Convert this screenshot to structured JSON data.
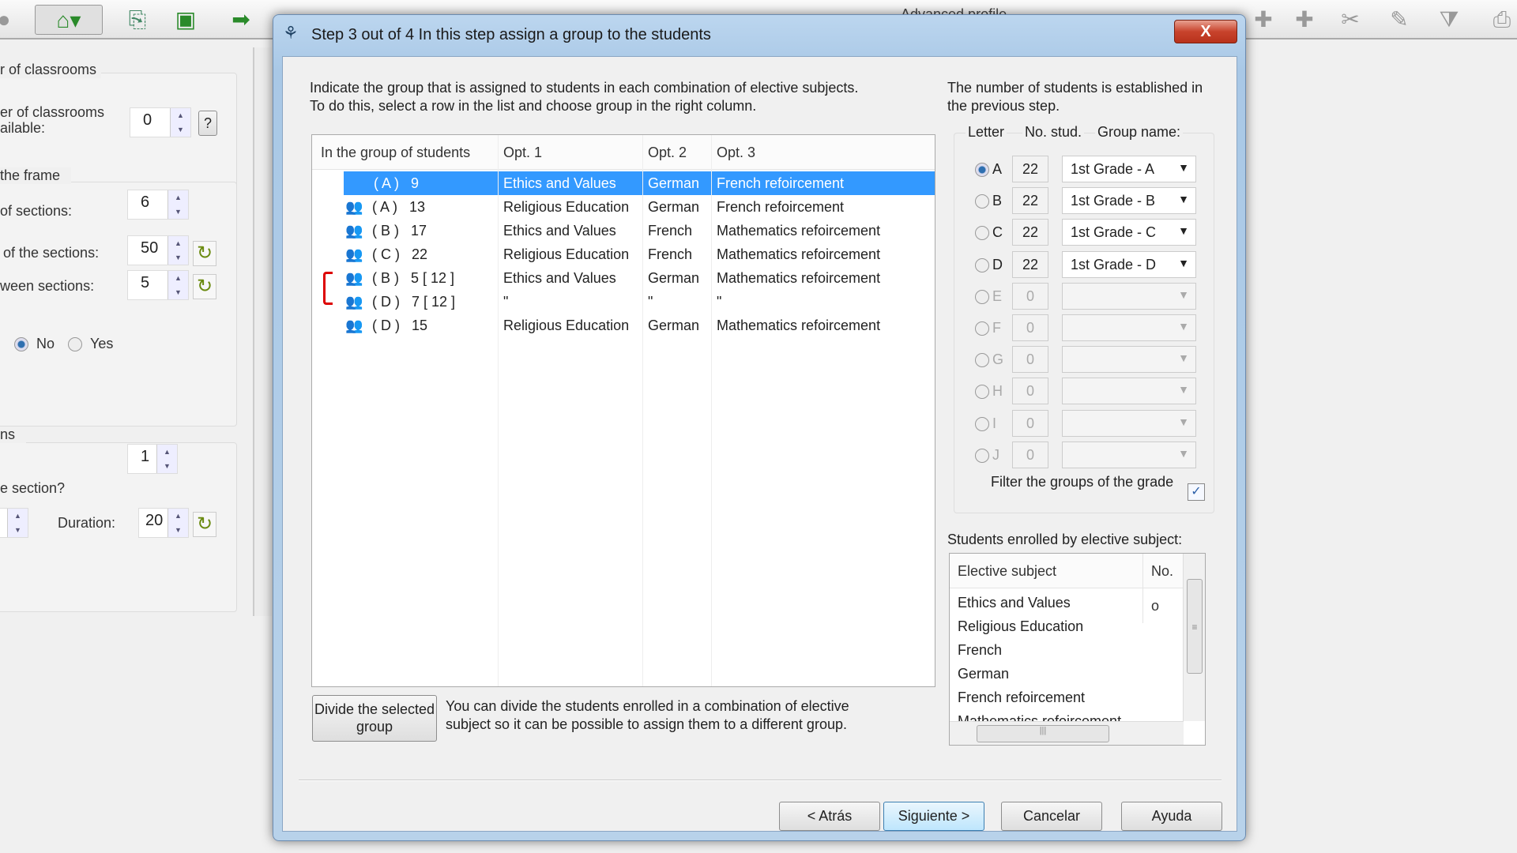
{
  "toolbar": {
    "advanced_profile": "Advanced profile"
  },
  "left_panel": {
    "classrooms_group": "r of classrooms",
    "classrooms_label": "er of classrooms\nailable:",
    "classrooms_value": "0",
    "help_label": "?",
    "frame_group": "the frame",
    "sections_label": "of sections:",
    "sections_value": "6",
    "duration_label": "of the sections:",
    "duration_value": "50",
    "between_label": "ween sections:",
    "between_value": "5",
    "radio_no": "No",
    "radio_yes": "Yes",
    "radio_selected": "No",
    "group3": "ns",
    "group3_value": "1",
    "question": "e section?",
    "duration2_label": "Duration:",
    "duration2_value": "20"
  },
  "dialog": {
    "title": "Step 3 out of 4  In this step assign a group to the students",
    "close_label": "X",
    "instructions": "Indicate the group that is assigned to students in each combination of elective subjects. To do this, select a row in the list and choose group in the right column.",
    "table": {
      "columns": [
        "In the group of students",
        "Opt. 1",
        "Opt. 2",
        "Opt. 3"
      ],
      "rows": [
        {
          "letter": "( A )",
          "count": "9",
          "opt1": "Ethics and Values",
          "opt2": "German",
          "opt3": "French refoircement",
          "selected": true
        },
        {
          "letter": "( A )",
          "count": "13",
          "opt1": "Religious Education",
          "opt2": "German",
          "opt3": "French refoircement"
        },
        {
          "letter": "( B )",
          "count": "17",
          "opt1": "Ethics and Values",
          "opt2": "French",
          "opt3": "Mathematics refoircement"
        },
        {
          "letter": "( C )",
          "count": "22",
          "opt1": "Religious Education",
          "opt2": "French",
          "opt3": "Mathematics refoircement"
        },
        {
          "letter": "( B )",
          "count": "5 [ 12 ]",
          "opt1": "Ethics and Values",
          "opt2": "German",
          "opt3": "Mathematics refoircement"
        },
        {
          "letter": "( D )",
          "count": "7 [ 12 ]",
          "opt1": "\"",
          "opt2": "\"",
          "opt3": "\""
        },
        {
          "letter": "( D )",
          "count": "15",
          "opt1": "Religious Education",
          "opt2": "German",
          "opt3": "Mathematics refoircement"
        }
      ]
    },
    "divide_button": "Divide the selected group",
    "divide_help": "You can divide the students enrolled in a combination of elective subject so it can be possible to assign them to a different group.",
    "right_info": "The number of students is established in the previous step.",
    "groups_header": {
      "letter": "Letter",
      "num": "No. stud.",
      "name": "Group name:"
    },
    "groups": [
      {
        "letter": "A",
        "num": "22",
        "name": "1st Grade - A",
        "selected": true
      },
      {
        "letter": "B",
        "num": "22",
        "name": "1st Grade - B"
      },
      {
        "letter": "C",
        "num": "22",
        "name": "1st Grade - C"
      },
      {
        "letter": "D",
        "num": "22",
        "name": "1st Grade - D"
      },
      {
        "letter": "E",
        "num": "0",
        "name": "",
        "disabled": true
      },
      {
        "letter": "F",
        "num": "0",
        "name": "",
        "disabled": true
      },
      {
        "letter": "G",
        "num": "0",
        "name": "",
        "disabled": true
      },
      {
        "letter": "H",
        "num": "0",
        "name": "",
        "disabled": true
      },
      {
        "letter": "I",
        "num": "0",
        "name": "",
        "disabled": true
      },
      {
        "letter": "J",
        "num": "0",
        "name": "",
        "disabled": true
      }
    ],
    "filter_label": "Filter the groups of the grade",
    "filter_checked": true,
    "enrolled_label": "Students enrolled by elective subject:",
    "enrolled_columns": [
      "Elective subject",
      "No. o"
    ],
    "enrolled_rows": [
      "Ethics and Values",
      "Religious Education",
      "French",
      "German",
      "French refoircement",
      "Mathematics refoircement"
    ],
    "buttons": {
      "back": "< Atrás",
      "next": "Siguiente >",
      "cancel": "Cancelar",
      "help": "Ayuda"
    }
  }
}
